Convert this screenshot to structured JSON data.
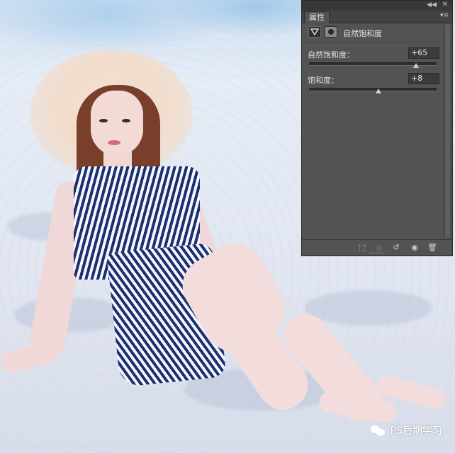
{
  "panel": {
    "tab_label": "属性",
    "adjustment_title": "自然饱和度",
    "vibrance": {
      "label": "自然饱和度：",
      "value": "+65",
      "level": 65
    },
    "saturation": {
      "label": "饱和度：",
      "value": "+8",
      "level": 8
    },
    "footer_icons": [
      "clip-to-layer-icon",
      "view-previous-state-icon",
      "reset-icon",
      "visibility-eye-icon",
      "trash-icon"
    ]
  },
  "watermark": {
    "text": "PS后期学习"
  },
  "colors": {
    "panel_bg": "#535353",
    "panel_dark": "#383838",
    "dress_navy": "#1d2f6e"
  }
}
